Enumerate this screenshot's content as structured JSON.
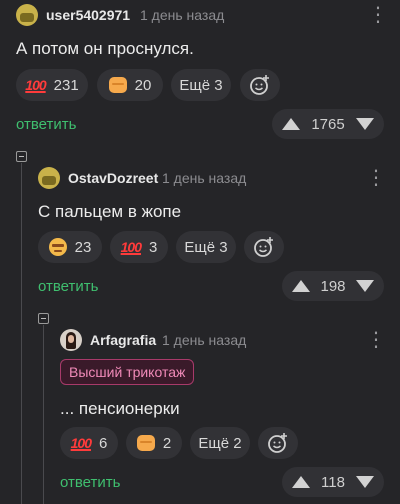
{
  "comments": [
    {
      "user": "user5402971",
      "time": "1 день назад",
      "text": "А потом он проснулся.",
      "reactions": [
        {
          "icon": "100-icon",
          "emoji": "100",
          "count": "231"
        },
        {
          "icon": "fist-bump-icon",
          "count": "20"
        }
      ],
      "more_label": "Ещё 3",
      "reply_label": "ответить",
      "rating": "1765"
    },
    {
      "user": "OstavDozreet",
      "time": "1 день назад",
      "text": "С пальцем в жопе",
      "reactions": [
        {
          "icon": "grimace-face-icon",
          "count": "23"
        },
        {
          "icon": "100-icon",
          "emoji": "100",
          "count": "3"
        }
      ],
      "more_label": "Ещё 3",
      "reply_label": "ответить",
      "rating": "198"
    },
    {
      "user": "Arfagrafia",
      "time": "1 день назад",
      "badge": "Высший трикотаж",
      "text": "... пенсионерки",
      "reactions": [
        {
          "icon": "100-icon",
          "emoji": "100",
          "count": "6"
        },
        {
          "icon": "fist-bump-icon",
          "count": "2"
        }
      ],
      "more_label": "Ещё 2",
      "reply_label": "ответить",
      "rating": "118"
    }
  ]
}
